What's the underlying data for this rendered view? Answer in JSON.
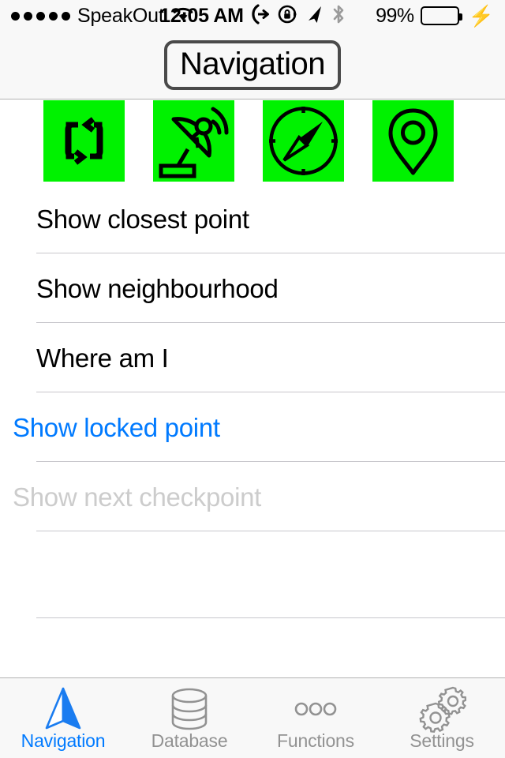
{
  "status_bar": {
    "signal_dots": 5,
    "carrier": "SpeakOut",
    "wifi_icon": "wifi-icon",
    "time": "12:05 AM",
    "call_forwarding_icon": "call-forwarding-icon",
    "rotation_lock_icon": "rotation-lock-icon",
    "location_icon": "location-arrow-icon",
    "bluetooth_icon": "bluetooth-icon",
    "battery_percent": "99%",
    "battery_color": "#4cd764",
    "charging_icon": "lightning-bolt-icon"
  },
  "navbar": {
    "title": "Navigation"
  },
  "icon_row": {
    "background_color": "#00f200",
    "items": [
      {
        "name": "refresh-loop-icon",
        "label": "Refresh"
      },
      {
        "name": "satellite-dish-icon",
        "label": "Satellite"
      },
      {
        "name": "compass-icon",
        "label": "Compass"
      },
      {
        "name": "map-pin-icon",
        "label": "Map pin"
      }
    ]
  },
  "list": {
    "rows": [
      {
        "label": "Show closest point",
        "state": "enabled",
        "color": "#000000"
      },
      {
        "label": "Show neighbourhood",
        "state": "enabled",
        "color": "#000000"
      },
      {
        "label": "Where am I",
        "state": "enabled",
        "color": "#000000"
      },
      {
        "label": "Show locked point",
        "state": "highlighted",
        "color": "#007aff"
      },
      {
        "label": "Show next checkpoint",
        "state": "disabled",
        "color": "#cccccc"
      }
    ]
  },
  "tabbar": {
    "items": [
      {
        "label": "Navigation",
        "icon": "navigation-arrow-icon",
        "active": true,
        "color": "#007aff"
      },
      {
        "label": "Database",
        "icon": "database-icon",
        "active": false,
        "color": "#929292"
      },
      {
        "label": "Functions",
        "icon": "three-dots-icon",
        "active": false,
        "color": "#929292"
      },
      {
        "label": "Settings",
        "icon": "gears-icon",
        "active": false,
        "color": "#929292"
      }
    ]
  }
}
